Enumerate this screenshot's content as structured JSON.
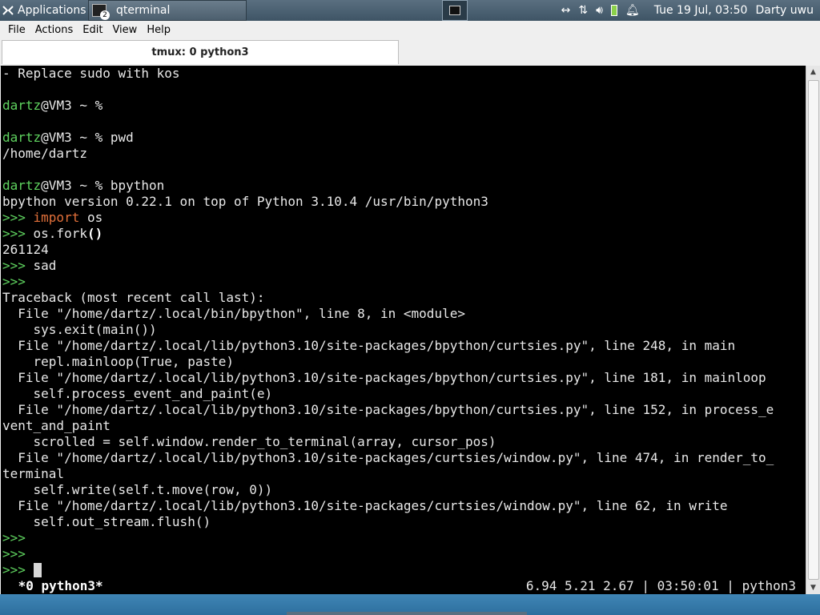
{
  "panel": {
    "applications_label": "Applications",
    "task_label": "qterminal",
    "task_badge": "2",
    "clock": "Tue 19 Jul, 03:50",
    "user": "Darty uwu",
    "tray_icons": [
      "network-arrows-icon",
      "transfer-icon",
      "volume-icon",
      "battery-icon",
      "notification-bell-icon"
    ]
  },
  "menubar": {
    "file": "File",
    "actions": "Actions",
    "edit": "Edit",
    "view": "View",
    "help": "Help"
  },
  "tab": {
    "title": "tmux: 0 python3"
  },
  "terminal": {
    "lines": [
      [
        "- Replace sudo with kos"
      ],
      [
        ""
      ],
      [
        "dartz",
        "@VM3 ~ %"
      ],
      [
        ""
      ],
      [
        "dartz",
        "@VM3 ~ % pwd"
      ],
      [
        "/home/dartz"
      ],
      [
        ""
      ],
      [
        "dartz",
        "@VM3 ~ % bpython"
      ],
      [
        "bpython version 0.22.1 on top of Python 3.10.4 /usr/bin/python3"
      ],
      [
        ">>> ",
        "import",
        " os"
      ],
      [
        ">>> ",
        "os.fork",
        "()"
      ],
      [
        "261124"
      ],
      [
        ">>> ",
        "sad"
      ],
      [
        ">>> "
      ],
      [
        "Traceback (most recent call last):"
      ],
      [
        "  File \"/home/dartz/.local/bin/bpython\", line 8, in <module>"
      ],
      [
        "    sys.exit(main())"
      ],
      [
        "  File \"/home/dartz/.local/lib/python3.10/site-packages/bpython/curtsies.py\", line 248, in main"
      ],
      [
        "    repl.mainloop(True, paste)"
      ],
      [
        "  File \"/home/dartz/.local/lib/python3.10/site-packages/bpython/curtsies.py\", line 181, in mainloop"
      ],
      [
        "    self.process_event_and_paint(e)"
      ],
      [
        "  File \"/home/dartz/.local/lib/python3.10/site-packages/bpython/curtsies.py\", line 152, in process_e"
      ],
      [
        "vent_and_paint"
      ],
      [
        "    scrolled = self.window.render_to_terminal(array, cursor_pos)"
      ],
      [
        "  File \"/home/dartz/.local/lib/python3.10/site-packages/curtsies/window.py\", line 474, in render_to_"
      ],
      [
        "terminal"
      ],
      [
        "    self.write(self.t.move(row, 0))"
      ],
      [
        "  File \"/home/dartz/.local/lib/python3.10/site-packages/curtsies/window.py\", line 62, in write"
      ],
      [
        "    self.out_stream.flush()"
      ],
      [
        ">>> "
      ],
      [
        ">>> "
      ],
      [
        ">>> "
      ]
    ],
    "status_left": " *0 python3*",
    "status_right": "6.94 5.21 2.67 | 03:50:01 | python3",
    "colors": {
      "prompt": "#5fd35f",
      "keyword": "#e2703a",
      "background": "#000000"
    }
  }
}
